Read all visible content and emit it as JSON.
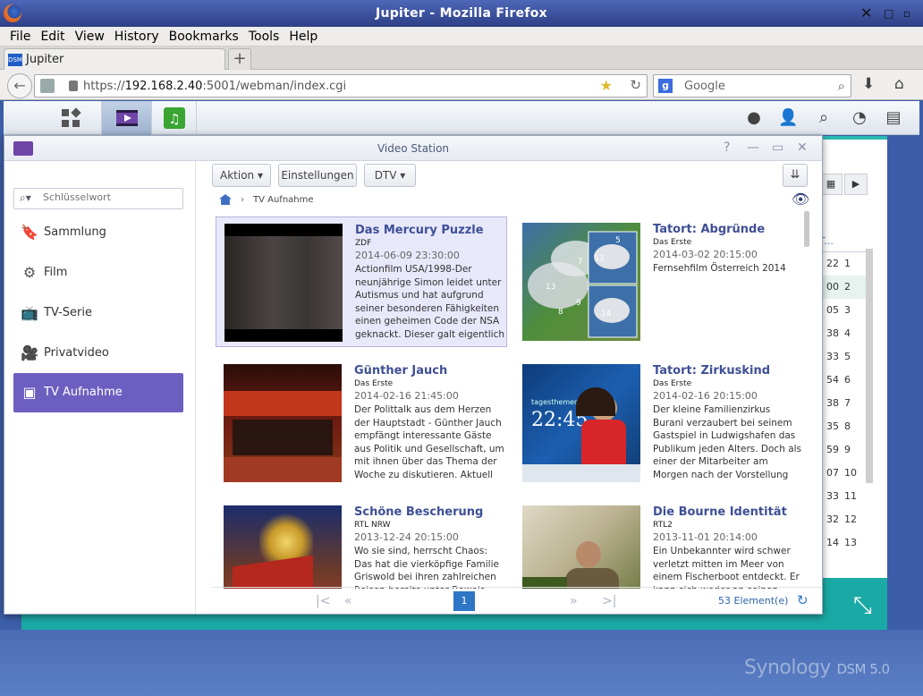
{
  "browser": {
    "title": "Jupiter - Mozilla Firefox",
    "menu": [
      "File",
      "Edit",
      "View",
      "History",
      "Bookmarks",
      "Tools",
      "Help"
    ],
    "tab_label": "Jupiter",
    "favicon_text": "DSM",
    "url_prefix": "https://",
    "url_host": "192.168.2.40",
    "url_rest": ":5001/webman/index.cgi",
    "search_placeholder": "Google"
  },
  "window": {
    "title": "Video Station"
  },
  "sidebar": {
    "search_placeholder": "Schlüsselwort",
    "items": [
      {
        "label": "Sammlung",
        "icon": "bookmark-icon"
      },
      {
        "label": "Film",
        "icon": "film-reel-icon"
      },
      {
        "label": "TV-Serie",
        "icon": "tv-icon"
      },
      {
        "label": "Privatvideo",
        "icon": "camcorder-icon"
      },
      {
        "label": "TV Aufnahme",
        "icon": "rec-tv-icon"
      }
    ]
  },
  "toolbar": {
    "action": "Aktion",
    "settings": "Einstellungen",
    "dtv": "DTV"
  },
  "breadcrumb": {
    "current": "TV Aufnahme"
  },
  "recordings": [
    {
      "title": "Das Mercury Puzzle",
      "channel": "ZDF",
      "date": "2014-06-09 23:30:00",
      "desc": "Actionfilm USA/1998-Der neunjährige Simon leidet unter Autismus und hat aufgrund seiner besonderen Fähigkeiten einen geheimen Code der NSA geknackt. Dieser galt eigentlich"
    },
    {
      "title": "Tatort: Abgründe",
      "channel": "Das Erste",
      "date": "2014-03-02 20:15:00",
      "desc": "Fernsehfilm Österreich 2014"
    },
    {
      "title": "Günther Jauch",
      "channel": "Das Erste",
      "date": "2014-02-16 21:45:00",
      "desc": "Der Polittalk aus dem Herzen der Hauptstadt - Günther Jauch empfängt interessante Gäste aus Politik und Gesellschaft, um mit ihnen über das Thema der Woche zu diskutieren. Aktuell soll es"
    },
    {
      "title": "Tatort: Zirkuskind",
      "channel": "Das Erste",
      "date": "2014-02-16 20:15:00",
      "desc": "Der kleine Familienzirkus Burani verzaubert bei seinem Gastspiel in Ludwigshafen das Publikum jeden Alters. Doch als einer der Mitarbeiter am Morgen nach der Vorstellung erschlagen in der"
    },
    {
      "title": "Schöne Bescherung",
      "channel": "RTL NRW",
      "date": "2013-12-24 20:15:00",
      "desc": "Wo sie sind, herrscht Chaos: Das hat die vierköpfige Familie Griswold bei ihren zahlreichen Reisen bereits unter Beweis"
    },
    {
      "title": "Die Bourne Identität",
      "channel": "RTL2",
      "date": "2013-11-01 20:14:00",
      "desc": "Ein Unbekannter wird schwer verletzt mitten im Meer von einem Fischerboot entdeckt. Er kann sich weder an seinen Namen"
    }
  ],
  "thumb_text": {
    "weather_temps": [
      "13",
      "9",
      "8",
      "7",
      "5",
      "13",
      "14"
    ],
    "news_time": "22:45",
    "news_label": "tagesthemen"
  },
  "pager": {
    "page": "1",
    "count": "53 Element(e)"
  },
  "bg_list": {
    "header": "T...",
    "rows": [
      {
        "a": "22",
        "b": "1"
      },
      {
        "a": "00",
        "b": "2"
      },
      {
        "a": "05",
        "b": "3"
      },
      {
        "a": "38",
        "b": "4"
      },
      {
        "a": "33",
        "b": "5"
      },
      {
        "a": "54",
        "b": "6"
      },
      {
        "a": "38",
        "b": "7"
      },
      {
        "a": "35",
        "b": "8"
      },
      {
        "a": "59",
        "b": "9"
      },
      {
        "a": "07",
        "b": "10"
      },
      {
        "a": "33",
        "b": "11"
      },
      {
        "a": "32",
        "b": "12"
      },
      {
        "a": "14",
        "b": "13"
      }
    ]
  },
  "brand": {
    "name": "Synology",
    "version": "DSM 5.0"
  },
  "colors": {
    "accent": "#6c5fc0",
    "title_blue": "#3f4f96",
    "page_blue": "#2d76c5"
  }
}
